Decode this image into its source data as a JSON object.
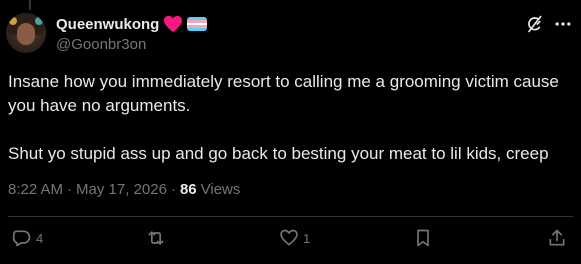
{
  "author": {
    "display_name": "Queenwukong",
    "handle": "@Goonbr3on",
    "badges": [
      "red-heart-icon",
      "transgender-flag-icon"
    ]
  },
  "tweet": {
    "paragraphs": [
      "Insane how you immediately resort to calling me a grooming victim cause you have no arguments.",
      "Shut yo stupid ass up and go back to besting your meat to lil kids, creep"
    ]
  },
  "meta": {
    "time": "8:22 AM",
    "separator": "·",
    "date": "May 17, 2026",
    "views_count": "86",
    "views_label": "Views"
  },
  "actions": {
    "reply_count": "4",
    "repost_count": "",
    "like_count": "1"
  },
  "colors": {
    "background": "#000000",
    "text": "#e7e9ea",
    "muted": "#71767b",
    "heart": "#f91880",
    "divider": "#2f3336"
  },
  "icons": [
    "grok-icon",
    "more-icon",
    "reply-icon",
    "repost-icon",
    "like-icon",
    "bookmark-icon",
    "share-icon"
  ]
}
